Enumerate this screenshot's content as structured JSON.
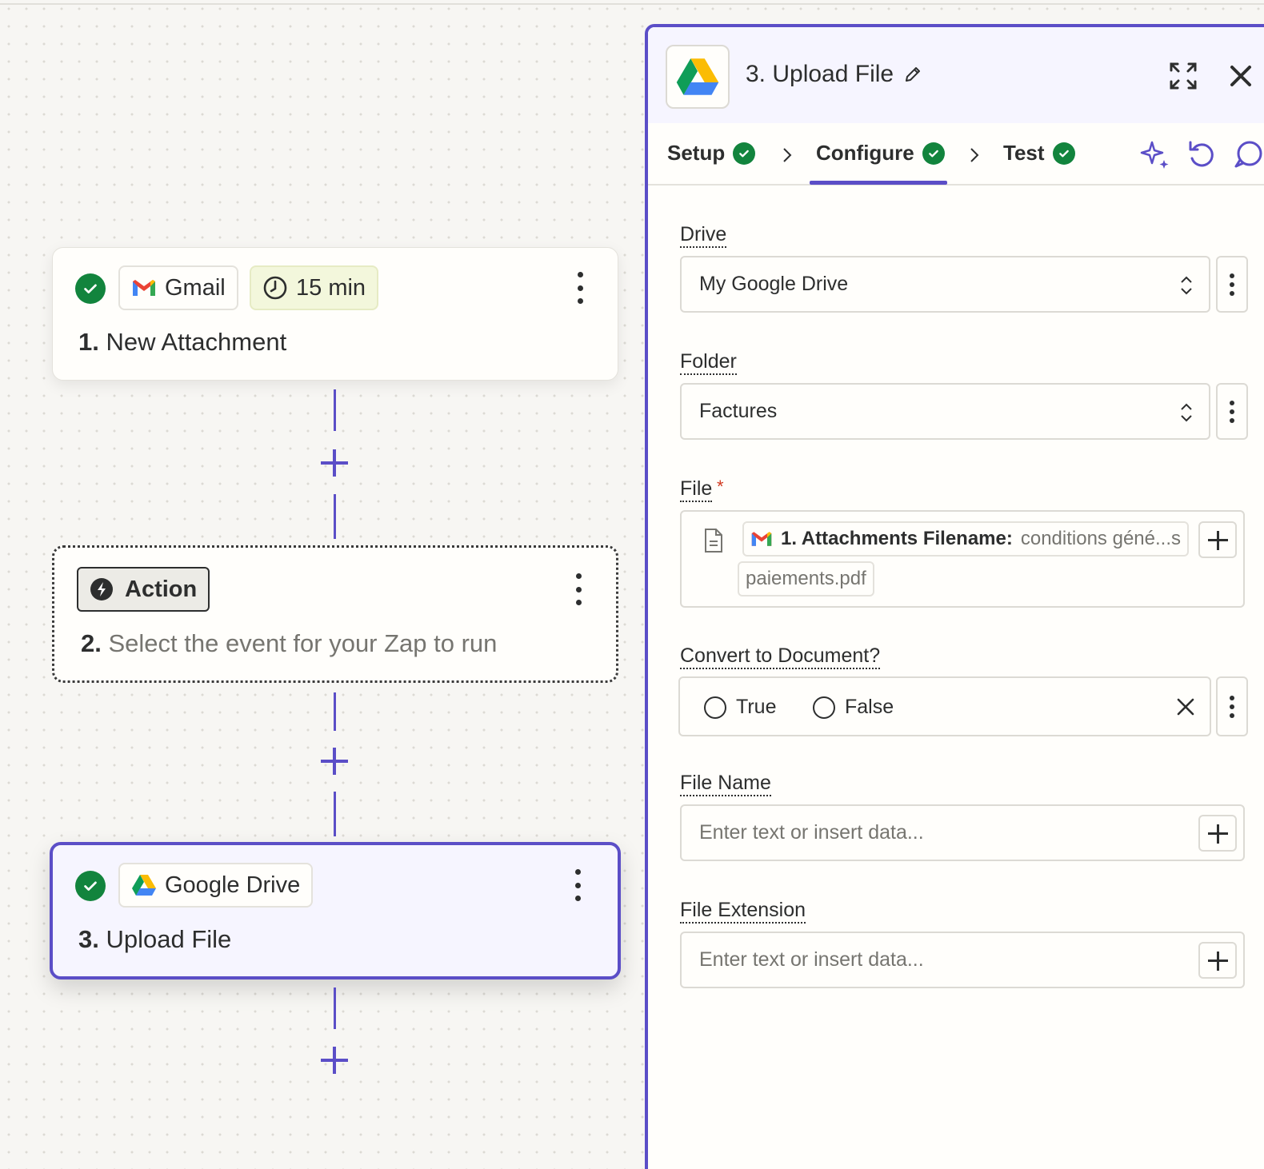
{
  "steps": [
    {
      "app_label": "Gmail",
      "time_label": "15 min",
      "title_number": "1.",
      "title_text": "New Attachment"
    },
    {
      "badge_label": "Action",
      "title_number": "2.",
      "title_text": "Select the event for your Zap to run"
    },
    {
      "app_label": "Google Drive",
      "title_number": "3.",
      "title_text": "Upload File"
    }
  ],
  "panel": {
    "title": "3. Upload File",
    "tabs": [
      {
        "label": "Setup"
      },
      {
        "label": "Configure"
      },
      {
        "label": "Test"
      }
    ],
    "fields": {
      "drive": {
        "label": "Drive",
        "value": "My Google Drive"
      },
      "folder": {
        "label": "Folder",
        "value": "Factures"
      },
      "file": {
        "label": "File",
        "required_mark": "*",
        "pill_key": "1. Attachments Filename:",
        "pill_value": "conditions géné...s",
        "pill_value_cont": "paiements.pdf"
      },
      "convert": {
        "label": "Convert to Document?",
        "option_true": "True",
        "option_false": "False"
      },
      "file_name": {
        "label": "File Name",
        "placeholder": "Enter text or insert data..."
      },
      "file_extension": {
        "label": "File Extension",
        "placeholder": "Enter text or insert data..."
      }
    }
  },
  "colors": {
    "accent": "#5b4ec7",
    "success": "#12843d",
    "required": "#d1391f"
  }
}
